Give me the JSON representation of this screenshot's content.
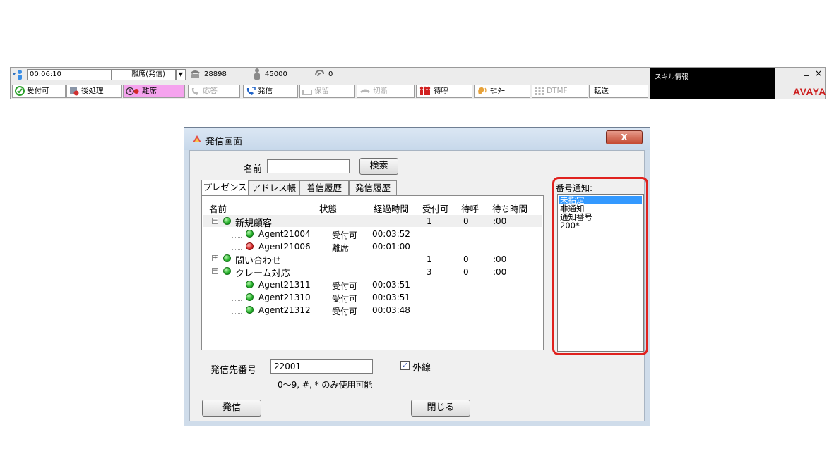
{
  "toolbar": {
    "timer": "00:06:10",
    "status_select": "離席(発信)",
    "extension": "28898",
    "agent_id": "45000",
    "queue_count": "0",
    "buttons": {
      "available": "受付可",
      "after_call": "後処理",
      "away": "離席",
      "answer": "応答",
      "dial": "発信",
      "hold": "保留",
      "disconnect": "切断",
      "waiting": "待呼",
      "monitor": "ﾓﾆﾀｰ",
      "dtmf": "DTMF",
      "transfer": "転送"
    },
    "skill_info_label": "スキル情報",
    "minimize": "_",
    "close": "×",
    "brand": "AVAYA"
  },
  "dialog": {
    "title": "発信画面",
    "close_label": "X",
    "name_label": "名前",
    "name_value": "",
    "search_label": "検索",
    "tabs": [
      "プレゼンス",
      "アドレス帳",
      "着信履歴",
      "発信履歴"
    ],
    "columns": [
      "名前",
      "状態",
      "経過時間",
      "受付可",
      "待呼",
      "待ち時間"
    ],
    "groups": [
      {
        "name": "新規顧客",
        "expand": "−",
        "available": "1",
        "waiting": "0",
        "wait_time": ":00",
        "agents": [
          {
            "name": "Agent21004",
            "status": "受付可",
            "elapsed": "00:03:52"
          },
          {
            "name": "Agent21006",
            "status": "離席",
            "elapsed": "00:01:00"
          }
        ]
      },
      {
        "name": "問い合わせ",
        "expand": "+",
        "available": "1",
        "waiting": "0",
        "wait_time": ":00",
        "agents": []
      },
      {
        "name": "クレーム対応",
        "expand": "−",
        "available": "3",
        "waiting": "0",
        "wait_time": ":00",
        "agents": [
          {
            "name": "Agent21311",
            "status": "受付可",
            "elapsed": "00:03:51"
          },
          {
            "name": "Agent21310",
            "status": "受付可",
            "elapsed": "00:03:51"
          },
          {
            "name": "Agent21312",
            "status": "受付可",
            "elapsed": "00:03:48"
          }
        ]
      }
    ],
    "caller_id_label": "番号通知:",
    "caller_id_options": [
      "未指定",
      "非通知",
      "通知番号",
      "200*"
    ],
    "caller_id_selected": "未指定",
    "dial_number_label": "発信先番号",
    "dial_number_value": "22001",
    "outside_line_label": "外線",
    "outside_line_checked": "✓",
    "hint": "0〜9, #, * のみ使用可能",
    "dial_button": "発信",
    "close_button": "閉じる"
  },
  "colors": {
    "away_pink": "#f5a3ee",
    "highlight_red": "#e0221f",
    "selection_blue": "#3399ff",
    "avaya_red": "#cc1f1f"
  }
}
